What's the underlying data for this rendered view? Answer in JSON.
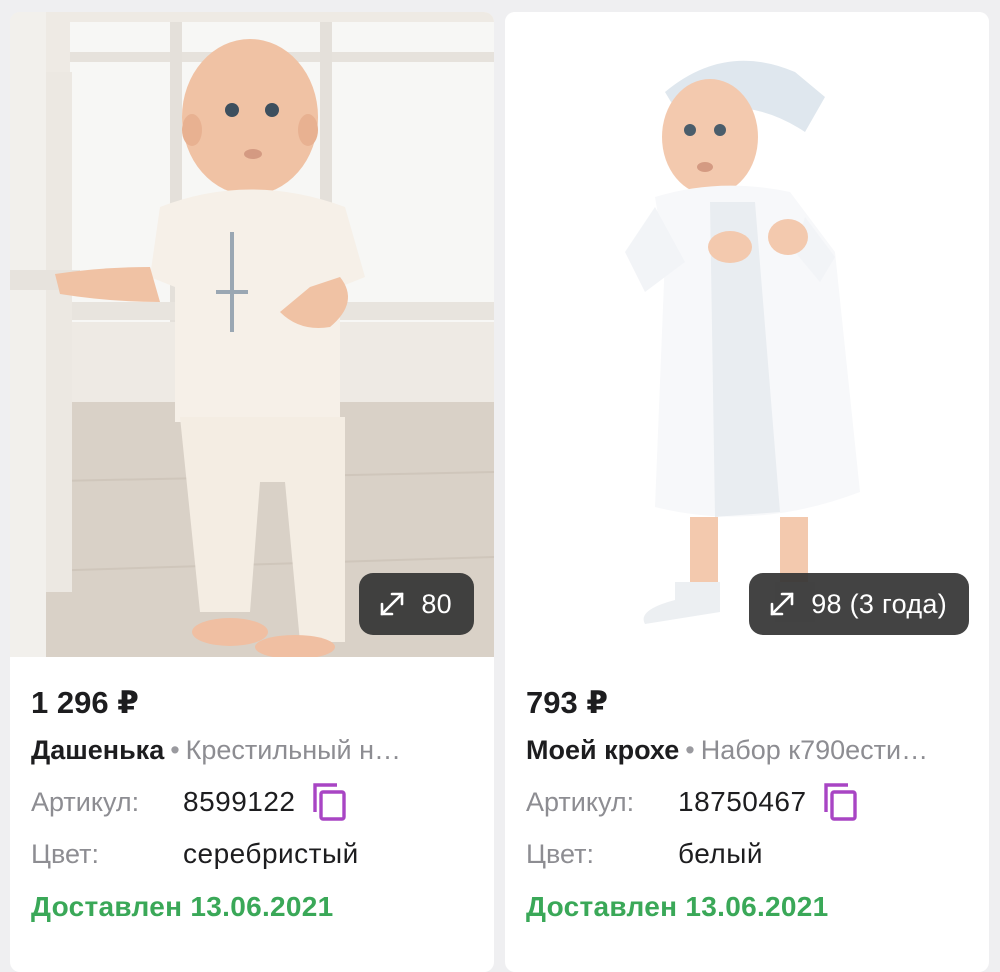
{
  "products": [
    {
      "size": "80",
      "price": "1 296 ₽",
      "brand": "Дашенька",
      "separator": "•",
      "name": "Крестильный н…",
      "article_label": "Артикул:",
      "article": "8599122",
      "color_label": "Цвет:",
      "color": "серебристый",
      "status": "Доставлен 13.06.2021"
    },
    {
      "size": "98 (3 года)",
      "price": "793 ₽",
      "brand": "Моей крохе",
      "separator": "•",
      "name": "Набор к790ести…",
      "article_label": "Артикул:",
      "article": "18750467",
      "color_label": "Цвет:",
      "color": "белый",
      "status": "Доставлен 13.06.2021"
    }
  ],
  "colors": {
    "status_green": "#3aa858",
    "copy_icon_purple": "#a845c4",
    "badge_bg": "#333333"
  },
  "icons": {
    "expand": "expand-arrows-icon",
    "copy": "copy-icon"
  }
}
